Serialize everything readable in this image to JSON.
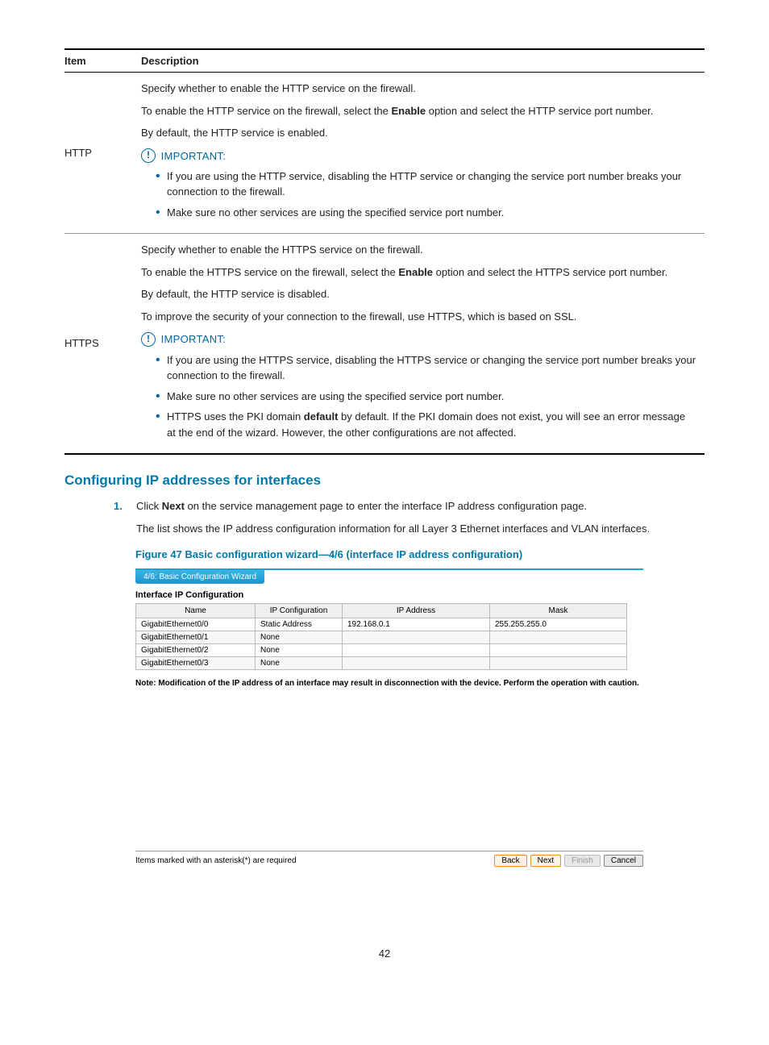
{
  "table": {
    "head_item": "Item",
    "head_desc": "Description",
    "rows": [
      {
        "item": "HTTP",
        "p1": "Specify whether to enable the HTTP service on the firewall.",
        "p2a": "To enable the HTTP service on the firewall, select the ",
        "p2b": "Enable",
        "p2c": " option and select the HTTP service port number.",
        "p3": "By default, the HTTP service is enabled.",
        "imp": "IMPORTANT:",
        "b1": "If you are using the HTTP service, disabling the HTTP service or changing the service port number breaks your connection to the firewall.",
        "b2": "Make sure no other services are using the specified service port number."
      },
      {
        "item": "HTTPS",
        "p1": "Specify whether to enable the HTTPS service on the firewall.",
        "p2a": "To enable the HTTPS service on the firewall, select the ",
        "p2b": "Enable",
        "p2c": " option and select the HTTPS service port number.",
        "p3": "By default, the HTTP service is disabled.",
        "p4": "To improve the security of your connection to the firewall, use HTTPS, which is based on SSL.",
        "imp": "IMPORTANT:",
        "b1": "If you are using the HTTPS service, disabling the HTTPS service or changing the service port number breaks your connection to the firewall.",
        "b2": "Make sure no other services are using the specified service port number.",
        "b3a": "HTTPS uses the PKI domain ",
        "b3b": "default",
        "b3c": " by default. If the PKI domain does not exist, you will see an error message at the end of the wizard. However, the other configurations are not affected."
      }
    ]
  },
  "section_title": "Configuring IP addresses for interfaces",
  "step1_a": "Click ",
  "step1_b": "Next",
  "step1_c": " on the service management page to enter the interface IP address configuration page.",
  "step1_d": "The list shows the IP address configuration information for all Layer 3 Ethernet interfaces and VLAN interfaces.",
  "figure_caption": "Figure 47 Basic configuration wizard—4/6 (interface IP address configuration)",
  "wizard": {
    "tab": "4/6: Basic Configuration Wizard",
    "sub": "Interface IP Configuration",
    "th1": "Name",
    "th2": "IP Configuration",
    "th3": "IP Address",
    "th4": "Mask",
    "rows": [
      {
        "c1": "GigabitEthernet0/0",
        "c2": "Static Address",
        "c3": "192.168.0.1",
        "c4": "255.255.255.0"
      },
      {
        "c1": "GigabitEthernet0/1",
        "c2": "None",
        "c3": "",
        "c4": ""
      },
      {
        "c1": "GigabitEthernet0/2",
        "c2": "None",
        "c3": "",
        "c4": ""
      },
      {
        "c1": "GigabitEthernet0/3",
        "c2": "None",
        "c3": "",
        "c4": ""
      }
    ],
    "note": "Note: Modification of the IP address of an interface may result in disconnection with the device. Perform the operation with caution.",
    "footer_left": "Items marked with an asterisk(*) are required",
    "btn_back": "Back",
    "btn_next": "Next",
    "btn_finish": "Finish",
    "btn_cancel": "Cancel"
  },
  "page_num": "42"
}
